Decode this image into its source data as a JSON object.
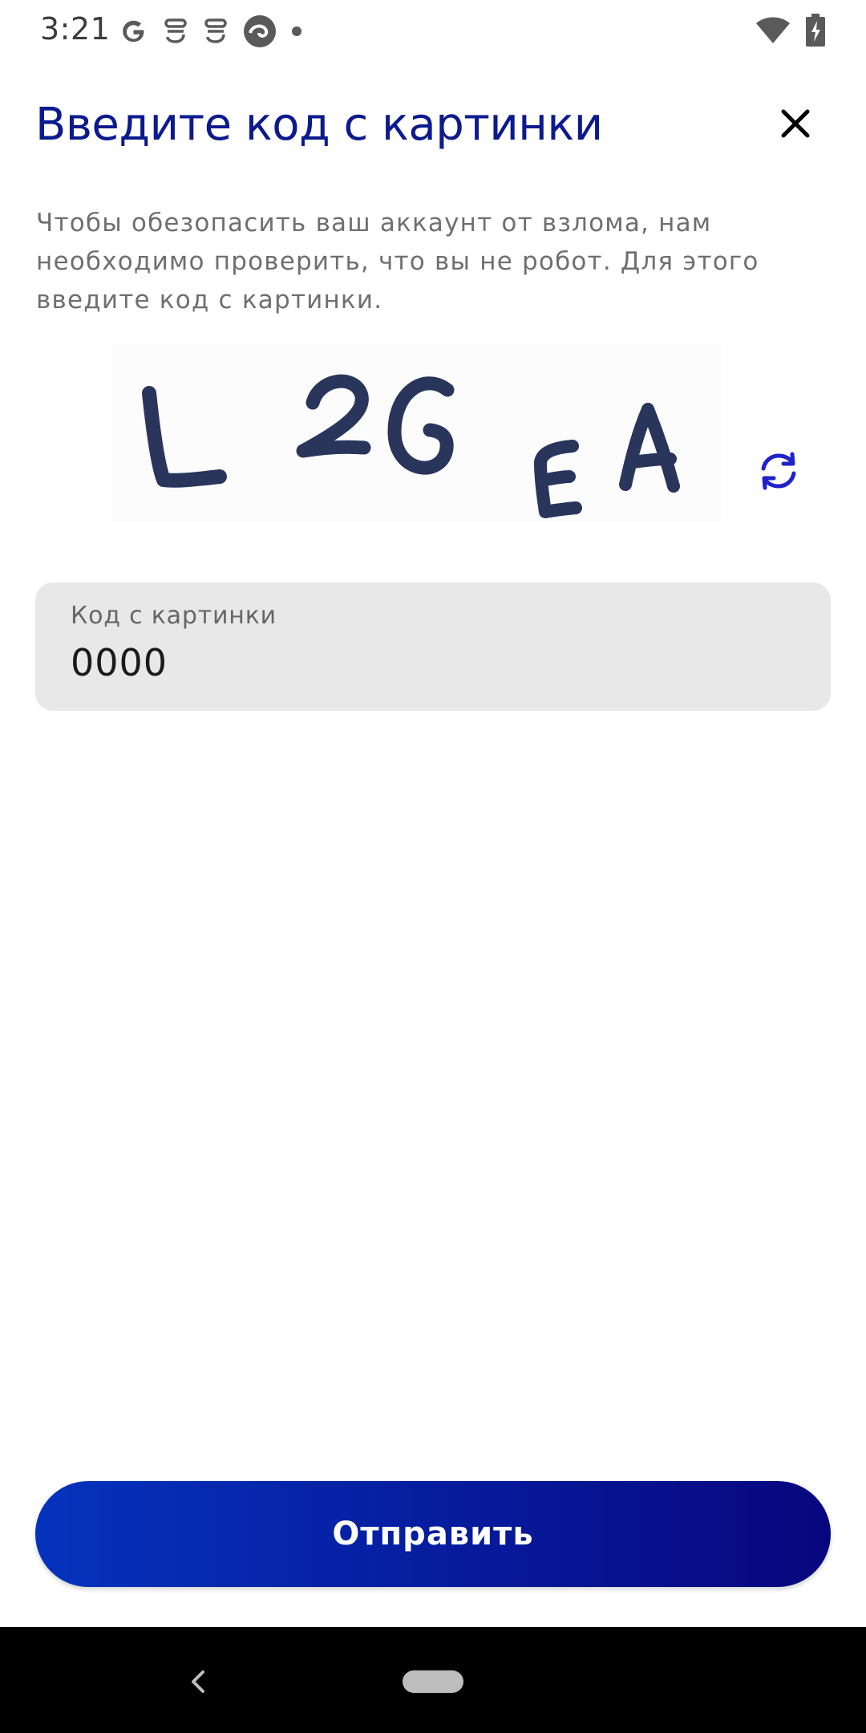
{
  "status_bar": {
    "time": "3:21",
    "left_icons": [
      "google-icon",
      "notification-s-icon",
      "notification-s-icon",
      "edge-browser-icon",
      "dot-icon"
    ],
    "right_icons": [
      "wifi-icon",
      "battery-charging-icon"
    ]
  },
  "header": {
    "title": "Введите код с картинки",
    "close_icon": "close-icon"
  },
  "description": "Чтобы обезопасить ваш аккаунт от взлома, нам необходимо проверить, что вы не робот. Для этого введите код с картинки.",
  "captcha": {
    "text": "L2GEA",
    "refresh_icon": "refresh-icon"
  },
  "code_field": {
    "label": "Код с картинки",
    "value": "0000"
  },
  "submit": {
    "label": "Отправить"
  },
  "colors": {
    "title": "#0c1a8e",
    "accent": "#1e22c8",
    "button_gradient_start": "#0533bd",
    "button_gradient_end": "#08067e",
    "field_background": "#e8e8e8",
    "captcha_ink": "#2a355c"
  },
  "nav_bar": {
    "back_icon": "back-chevron-icon",
    "home_icon": "home-pill-icon"
  }
}
